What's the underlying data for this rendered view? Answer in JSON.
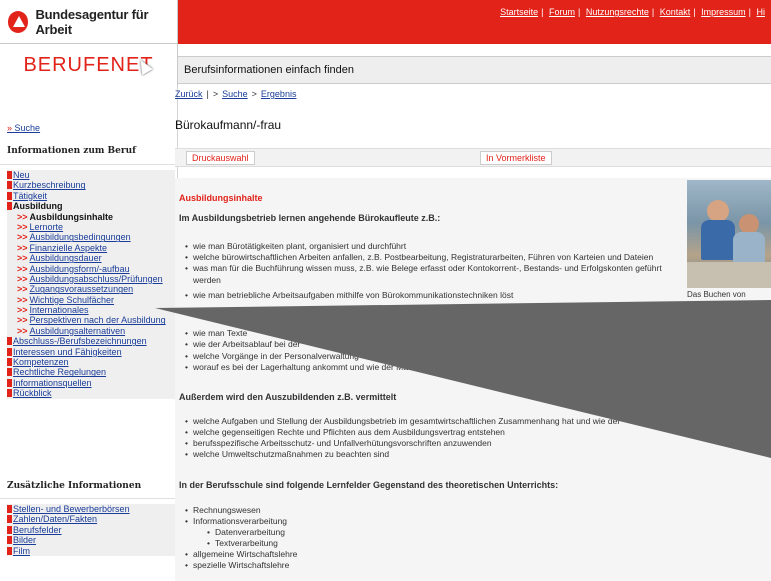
{
  "header": {
    "brand": "Bundesagentur für Arbeit",
    "top_links": [
      "Startseite",
      "Forum",
      "Nutzungsrechte",
      "Kontakt",
      "Impressum",
      "Hi"
    ]
  },
  "app": {
    "name": "BERUFENET",
    "tagline": "Berufsinformationen einfach finden"
  },
  "breadcrumb": {
    "back": "Zurück",
    "path": [
      "Suche",
      "Ergebnis"
    ]
  },
  "page_title": "Bürokaufmann/-frau",
  "actions": {
    "print": "Druckauswahl",
    "bookmark": "In Vormerkliste"
  },
  "sidebar": {
    "search_label": "Suche",
    "heading_info": "Informationen zum Beruf",
    "items": [
      {
        "label": "Neu",
        "type": "top"
      },
      {
        "label": "Kurzbeschreibung",
        "type": "top"
      },
      {
        "label": "Tätigkeit",
        "type": "top"
      },
      {
        "label": "Ausbildung",
        "type": "top-bold"
      },
      {
        "label": "Ausbildungsinhalte",
        "type": "sub-current"
      },
      {
        "label": "Lernorte",
        "type": "sub"
      },
      {
        "label": "Ausbildungsbedingungen",
        "type": "sub"
      },
      {
        "label": "Finanzielle Aspekte",
        "type": "sub"
      },
      {
        "label": "Ausbildungsdauer",
        "type": "sub"
      },
      {
        "label": "Ausbildungsform/-aufbau",
        "type": "sub"
      },
      {
        "label": "Ausbildungsabschluss/Prüfungen",
        "type": "sub"
      },
      {
        "label": "Zugangsvoraussetzungen",
        "type": "sub"
      },
      {
        "label": "Wichtige Schulfächer",
        "type": "sub"
      },
      {
        "label": "Internationales",
        "type": "sub"
      },
      {
        "label": "Perspektiven nach der Ausbildung",
        "type": "sub"
      },
      {
        "label": "Ausbildungsalternativen",
        "type": "sub"
      },
      {
        "label": "Abschluss-/Berufsbezeichnungen",
        "type": "top"
      },
      {
        "label": "Interessen und Fähigkeiten",
        "type": "top"
      },
      {
        "label": "Kompetenzen",
        "type": "top"
      },
      {
        "label": "Rechtliche Regelungen",
        "type": "top"
      },
      {
        "label": "Informationsquellen",
        "type": "top"
      },
      {
        "label": "Rückblick",
        "type": "top"
      }
    ],
    "sub_prefix": ">>",
    "heading_additional": "Zusätzliche Informationen",
    "additional_items": [
      "Stellen- und Bewerberbörsen",
      "Zahlen/Daten/Fakten",
      "Berufsfelder",
      "Bilder",
      "Film"
    ]
  },
  "content": {
    "section_title": "Ausbildungsinhalte",
    "company_heading": "Im Ausbildungsbetrieb lernen angehende Bürokaufleute z.B.:",
    "company_items": [
      "wie man Bürotätigkeiten plant, organisiert und durchführt",
      "welche bürowirtschaftlichen Arbeiten anfallen, z.B. Postbearbeitung, Registraturarbeiten, Führen von Karteien und Dateien",
      "was man für die Buchführung wissen muss, z.B. wie Belege erfasst oder Kontokorrent-, Bestands- und Erfolgskonten geführt",
      "werden",
      "wie man betriebliche Arbeitsaufgaben mithilfe von Bürokommunikationstechniken löst",
      "wie man Texte",
      "wie der Arbeitsablauf bei der",
      "welche Vorgänge in der Personalverwaltung",
      "worauf es bei der Lagerhaltung ankommt und wie der Material"
    ],
    "additional_heading": "Außerdem wird den Auszubildenden z.B. vermittelt",
    "additional_items": [
      "welche Aufgaben und Stellung der Ausbildungsbetrieb im gesamtwirtschaftlichen Zusammenhang hat und wie der",
      "welche gegenseitigen Rechte und Pflichten aus dem Ausbildungsvertrag entstehen",
      "berufsspezifische Arbeitsschutz- und Unfallverhütungsvorschriften anzuwenden",
      "welche Umweltschutzmaßnahmen zu beachten sind"
    ],
    "school_heading": "In der Berufsschule sind folgende Lernfelder Gegenstand des theoretischen Unterrichts:",
    "school_items": [
      {
        "label": "Rechnungswesen",
        "level": 1
      },
      {
        "label": "Informationsverarbeitung",
        "level": 1
      },
      {
        "label": "Datenverarbeitung",
        "level": 2
      },
      {
        "label": "Textverarbeitung",
        "level": 2
      },
      {
        "label": "allgemeine Wirtschaftslehre",
        "level": 1
      },
      {
        "label": "spezielle Wirtschaftslehre",
        "level": 1
      }
    ],
    "photo_caption": "Das Buchen von"
  },
  "colors": {
    "brand_red": "#e2231a",
    "link_blue": "#1a3d9a",
    "overlay_gray": "#666666"
  }
}
